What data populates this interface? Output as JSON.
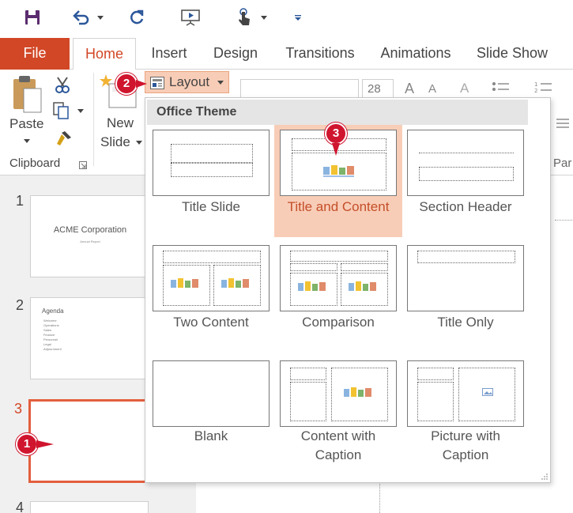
{
  "tabs": [
    "File",
    "Home",
    "Insert",
    "Design",
    "Transitions",
    "Animations",
    "Slide Show"
  ],
  "ribbon": {
    "paste_label": "Paste",
    "clipboard_label": "Clipboard",
    "new_slide_line1": "New",
    "new_slide_line2": "Slide",
    "layout_label": "Layout",
    "font_size": "28",
    "partial_label": "Par"
  },
  "layout_menu": {
    "header": "Office Theme",
    "items": [
      "Title Slide",
      "Title and Content",
      "Section Header",
      "Two Content",
      "Comparison",
      "Title Only",
      "Blank",
      "Content with",
      "Caption",
      "Picture with",
      "Caption"
    ]
  },
  "slides": {
    "numbers": [
      "1",
      "2",
      "3",
      "4"
    ],
    "slide1_title": "ACME Corporation",
    "slide1_subtitle": "Annual Report",
    "slide2_title": "Agenda",
    "slide2_bullets": [
      "Welcome",
      "Operations",
      "Sales",
      "Finance",
      "Personnel",
      "Legal",
      "Adjournment"
    ]
  },
  "callouts": [
    "1",
    "2",
    "3"
  ],
  "colors": {
    "accent": "#d24726",
    "callout": "#d0152e",
    "selected": "#f8cdb7"
  }
}
